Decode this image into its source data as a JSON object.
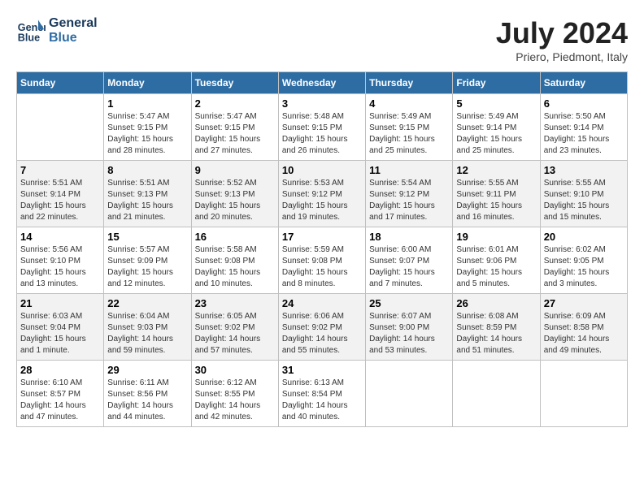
{
  "header": {
    "logo_line1": "General",
    "logo_line2": "Blue",
    "month_year": "July 2024",
    "location": "Priero, Piedmont, Italy"
  },
  "days_of_week": [
    "Sunday",
    "Monday",
    "Tuesday",
    "Wednesday",
    "Thursday",
    "Friday",
    "Saturday"
  ],
  "weeks": [
    [
      {
        "num": "",
        "sunrise": "",
        "sunset": "",
        "daylight": ""
      },
      {
        "num": "1",
        "sunrise": "Sunrise: 5:47 AM",
        "sunset": "Sunset: 9:15 PM",
        "daylight": "Daylight: 15 hours and 28 minutes."
      },
      {
        "num": "2",
        "sunrise": "Sunrise: 5:47 AM",
        "sunset": "Sunset: 9:15 PM",
        "daylight": "Daylight: 15 hours and 27 minutes."
      },
      {
        "num": "3",
        "sunrise": "Sunrise: 5:48 AM",
        "sunset": "Sunset: 9:15 PM",
        "daylight": "Daylight: 15 hours and 26 minutes."
      },
      {
        "num": "4",
        "sunrise": "Sunrise: 5:49 AM",
        "sunset": "Sunset: 9:15 PM",
        "daylight": "Daylight: 15 hours and 25 minutes."
      },
      {
        "num": "5",
        "sunrise": "Sunrise: 5:49 AM",
        "sunset": "Sunset: 9:14 PM",
        "daylight": "Daylight: 15 hours and 25 minutes."
      },
      {
        "num": "6",
        "sunrise": "Sunrise: 5:50 AM",
        "sunset": "Sunset: 9:14 PM",
        "daylight": "Daylight: 15 hours and 23 minutes."
      }
    ],
    [
      {
        "num": "7",
        "sunrise": "Sunrise: 5:51 AM",
        "sunset": "Sunset: 9:14 PM",
        "daylight": "Daylight: 15 hours and 22 minutes."
      },
      {
        "num": "8",
        "sunrise": "Sunrise: 5:51 AM",
        "sunset": "Sunset: 9:13 PM",
        "daylight": "Daylight: 15 hours and 21 minutes."
      },
      {
        "num": "9",
        "sunrise": "Sunrise: 5:52 AM",
        "sunset": "Sunset: 9:13 PM",
        "daylight": "Daylight: 15 hours and 20 minutes."
      },
      {
        "num": "10",
        "sunrise": "Sunrise: 5:53 AM",
        "sunset": "Sunset: 9:12 PM",
        "daylight": "Daylight: 15 hours and 19 minutes."
      },
      {
        "num": "11",
        "sunrise": "Sunrise: 5:54 AM",
        "sunset": "Sunset: 9:12 PM",
        "daylight": "Daylight: 15 hours and 17 minutes."
      },
      {
        "num": "12",
        "sunrise": "Sunrise: 5:55 AM",
        "sunset": "Sunset: 9:11 PM",
        "daylight": "Daylight: 15 hours and 16 minutes."
      },
      {
        "num": "13",
        "sunrise": "Sunrise: 5:55 AM",
        "sunset": "Sunset: 9:10 PM",
        "daylight": "Daylight: 15 hours and 15 minutes."
      }
    ],
    [
      {
        "num": "14",
        "sunrise": "Sunrise: 5:56 AM",
        "sunset": "Sunset: 9:10 PM",
        "daylight": "Daylight: 15 hours and 13 minutes."
      },
      {
        "num": "15",
        "sunrise": "Sunrise: 5:57 AM",
        "sunset": "Sunset: 9:09 PM",
        "daylight": "Daylight: 15 hours and 12 minutes."
      },
      {
        "num": "16",
        "sunrise": "Sunrise: 5:58 AM",
        "sunset": "Sunset: 9:08 PM",
        "daylight": "Daylight: 15 hours and 10 minutes."
      },
      {
        "num": "17",
        "sunrise": "Sunrise: 5:59 AM",
        "sunset": "Sunset: 9:08 PM",
        "daylight": "Daylight: 15 hours and 8 minutes."
      },
      {
        "num": "18",
        "sunrise": "Sunrise: 6:00 AM",
        "sunset": "Sunset: 9:07 PM",
        "daylight": "Daylight: 15 hours and 7 minutes."
      },
      {
        "num": "19",
        "sunrise": "Sunrise: 6:01 AM",
        "sunset": "Sunset: 9:06 PM",
        "daylight": "Daylight: 15 hours and 5 minutes."
      },
      {
        "num": "20",
        "sunrise": "Sunrise: 6:02 AM",
        "sunset": "Sunset: 9:05 PM",
        "daylight": "Daylight: 15 hours and 3 minutes."
      }
    ],
    [
      {
        "num": "21",
        "sunrise": "Sunrise: 6:03 AM",
        "sunset": "Sunset: 9:04 PM",
        "daylight": "Daylight: 15 hours and 1 minute."
      },
      {
        "num": "22",
        "sunrise": "Sunrise: 6:04 AM",
        "sunset": "Sunset: 9:03 PM",
        "daylight": "Daylight: 14 hours and 59 minutes."
      },
      {
        "num": "23",
        "sunrise": "Sunrise: 6:05 AM",
        "sunset": "Sunset: 9:02 PM",
        "daylight": "Daylight: 14 hours and 57 minutes."
      },
      {
        "num": "24",
        "sunrise": "Sunrise: 6:06 AM",
        "sunset": "Sunset: 9:02 PM",
        "daylight": "Daylight: 14 hours and 55 minutes."
      },
      {
        "num": "25",
        "sunrise": "Sunrise: 6:07 AM",
        "sunset": "Sunset: 9:00 PM",
        "daylight": "Daylight: 14 hours and 53 minutes."
      },
      {
        "num": "26",
        "sunrise": "Sunrise: 6:08 AM",
        "sunset": "Sunset: 8:59 PM",
        "daylight": "Daylight: 14 hours and 51 minutes."
      },
      {
        "num": "27",
        "sunrise": "Sunrise: 6:09 AM",
        "sunset": "Sunset: 8:58 PM",
        "daylight": "Daylight: 14 hours and 49 minutes."
      }
    ],
    [
      {
        "num": "28",
        "sunrise": "Sunrise: 6:10 AM",
        "sunset": "Sunset: 8:57 PM",
        "daylight": "Daylight: 14 hours and 47 minutes."
      },
      {
        "num": "29",
        "sunrise": "Sunrise: 6:11 AM",
        "sunset": "Sunset: 8:56 PM",
        "daylight": "Daylight: 14 hours and 44 minutes."
      },
      {
        "num": "30",
        "sunrise": "Sunrise: 6:12 AM",
        "sunset": "Sunset: 8:55 PM",
        "daylight": "Daylight: 14 hours and 42 minutes."
      },
      {
        "num": "31",
        "sunrise": "Sunrise: 6:13 AM",
        "sunset": "Sunset: 8:54 PM",
        "daylight": "Daylight: 14 hours and 40 minutes."
      },
      {
        "num": "",
        "sunrise": "",
        "sunset": "",
        "daylight": ""
      },
      {
        "num": "",
        "sunrise": "",
        "sunset": "",
        "daylight": ""
      },
      {
        "num": "",
        "sunrise": "",
        "sunset": "",
        "daylight": ""
      }
    ]
  ]
}
